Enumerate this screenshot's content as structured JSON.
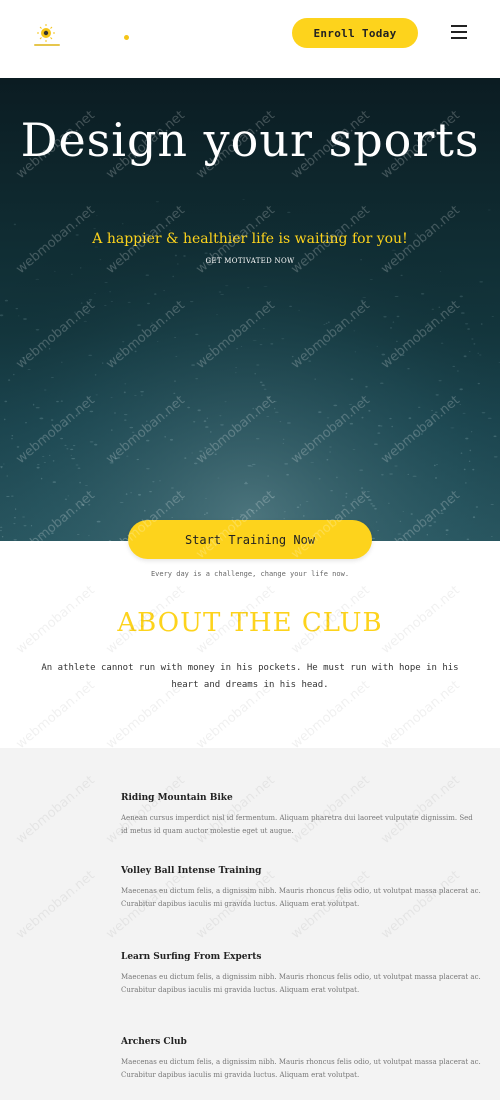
{
  "header": {
    "logo_name": "sun-emblem-logo",
    "enroll_label": "Enroll Today"
  },
  "hero": {
    "title": "Design your sports",
    "subtitle": "A happier & healthier life is waiting for you!",
    "motivation": "GET MOTIVATED NOW",
    "cta_label": "Start Training Now",
    "tagline": "Every day is a challenge, change your life now."
  },
  "about": {
    "title": "ABOUT THE CLUB",
    "text": "An athlete cannot run with money in his pockets. He must run with hope in his heart and dreams in his head."
  },
  "activities": [
    {
      "title": "Riding Mountain Bike",
      "text": "Aenean cursus imperdict nisl id fermentum. Aliquam pharetra dui laoreet vulputate dignissim. Sed id metus id quam auctor molestie eget ut augue."
    },
    {
      "title": "Volley Ball Intense Training",
      "text": "Maecenas eu dictum felis, a dignissim nibh. Mauris rhoncus felis odio, ut volutpat massa placerat ac. Curabitur dapibus iaculis mi gravida luctus. Aliquam erat volutpat."
    },
    {
      "title": "Learn Surfing From Experts",
      "text": "Maecenas eu dictum felis, a dignissim nibh. Mauris rhoncus felis odio, ut volutpat massa placerat ac. Curabitur dapibus iaculis mi gravida luctus. Aliquam erat volutpat."
    },
    {
      "title": "Archers Club",
      "text": "Maecenas eu dictum felis, a dignissim nibh. Mauris rhoncus felis odio, ut volutpat massa placerat ac. Curabitur dapibus iaculis mi gravida luctus. Aliquam erat volutpat."
    }
  ],
  "watermark": "webmoban.net",
  "colors": {
    "accent": "#fdd31c",
    "hero_dark": "#0b1c22",
    "section_bg": "#f3f3f3"
  }
}
